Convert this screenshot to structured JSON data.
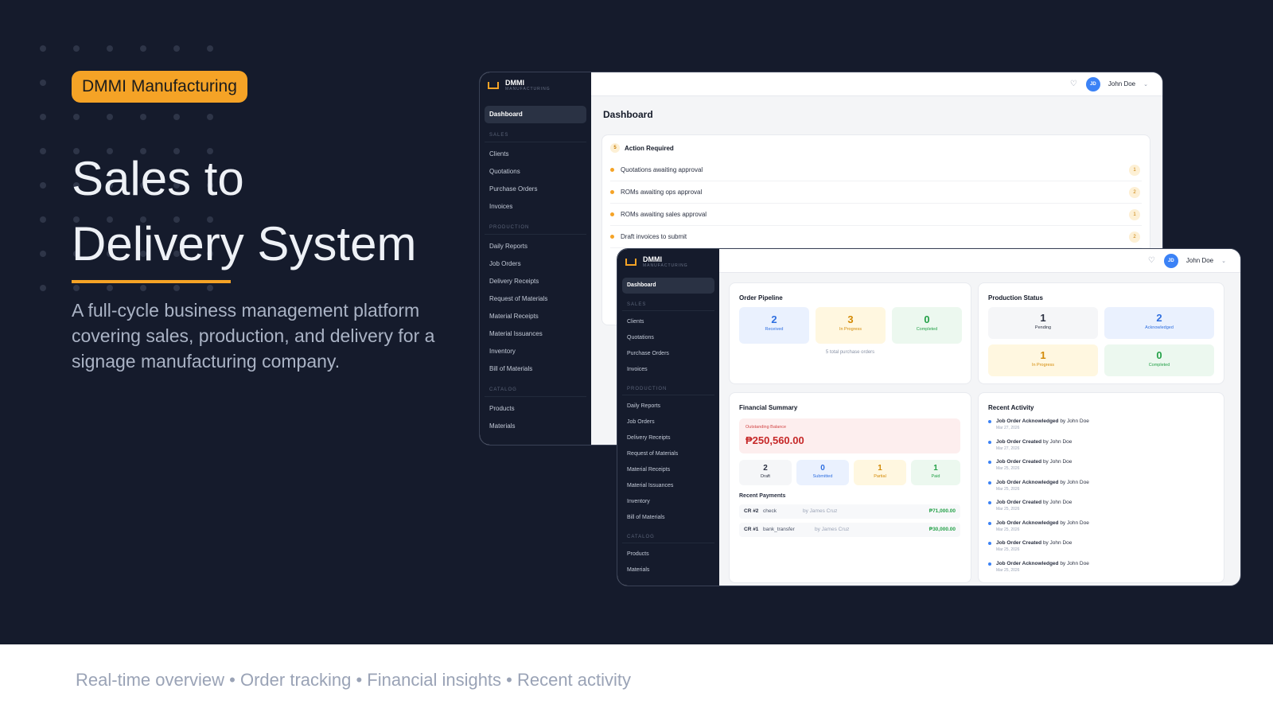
{
  "badge": "DMMI Manufacturing",
  "headline": {
    "line1": "Sales to",
    "line2": "Delivery System"
  },
  "subtitle": "A full-cycle business management platform covering sales, production, and delivery for a signage manufacturing company.",
  "footer": "Real-time overview • Order tracking • Financial insights • Recent activity",
  "colors": {
    "background": "#151b2c",
    "accent": "#f5a326",
    "primary": "#3b82f6",
    "success": "#24a148",
    "danger": "#c62828"
  },
  "brand": {
    "name": "DMMI",
    "sub": "MANUFACTURING"
  },
  "nav": {
    "dashboard": "Dashboard",
    "sales_section": "SALES",
    "sales": [
      "Clients",
      "Quotations",
      "Purchase Orders",
      "Invoices"
    ],
    "production_section": "PRODUCTION",
    "production": [
      "Daily Reports",
      "Job Orders",
      "Delivery Receipts",
      "Request of Materials",
      "Material Receipts",
      "Material Issuances",
      "Inventory",
      "Bill of Materials"
    ],
    "catalog_section": "CATALOG",
    "catalog": [
      "Products",
      "Materials"
    ]
  },
  "user": {
    "initials": "JD",
    "name": "John Doe"
  },
  "icons": {
    "bell": "bell-icon",
    "chevron": "chevron-down-icon",
    "logo": "factory-logo-icon"
  },
  "win1": {
    "page_title": "Dashboard",
    "action": {
      "title": "Action Required",
      "count": "5",
      "items": [
        {
          "label": "Quotations awaiting approval",
          "count": "1"
        },
        {
          "label": "ROMs awaiting ops approval",
          "count": "2"
        },
        {
          "label": "ROMs awaiting sales approval",
          "count": "1"
        },
        {
          "label": "Draft invoices to submit",
          "count": "2"
        }
      ]
    }
  },
  "pipeline": {
    "title": "Order Pipeline",
    "received": {
      "value": "2",
      "label": "Received"
    },
    "in_progress": {
      "value": "3",
      "label": "In Progress"
    },
    "completed": {
      "value": "0",
      "label": "Completed"
    },
    "note": "5 total purchase orders"
  },
  "production_status": {
    "title": "Production Status",
    "pending": {
      "value": "1",
      "label": "Pending"
    },
    "acknowledged": {
      "value": "2",
      "label": "Acknowledged"
    },
    "in_progress": {
      "value": "1",
      "label": "In Progress"
    },
    "completed": {
      "value": "0",
      "label": "Completed"
    }
  },
  "financial": {
    "title": "Financial Summary",
    "balance_label": "Outstanding Balance",
    "balance": "₱250,560.00",
    "draft": {
      "value": "2",
      "label": "Draft"
    },
    "submitted": {
      "value": "0",
      "label": "Submitted"
    },
    "partial": {
      "value": "1",
      "label": "Partial"
    },
    "paid": {
      "value": "1",
      "label": "Paid"
    },
    "payments_title": "Recent Payments",
    "payments": [
      {
        "ref": "CR #2",
        "method": "check",
        "by": "by James Cruz",
        "amount": "₱71,000.00"
      },
      {
        "ref": "CR #1",
        "method": "bank_transfer",
        "by": "by James Cruz",
        "amount": "₱30,000.00"
      }
    ]
  },
  "activity": {
    "title": "Recent Activity",
    "items": [
      {
        "action": "Job Order Acknowledged",
        "by": "by John Doe",
        "date": "Mar 27, 2026"
      },
      {
        "action": "Job Order Created",
        "by": "by John Doe",
        "date": "Mar 27, 2026"
      },
      {
        "action": "Job Order Created",
        "by": "by John Doe",
        "date": "Mar 25, 2026"
      },
      {
        "action": "Job Order Acknowledged",
        "by": "by John Doe",
        "date": "Mar 25, 2026"
      },
      {
        "action": "Job Order Created",
        "by": "by John Doe",
        "date": "Mar 25, 2026"
      },
      {
        "action": "Job Order Acknowledged",
        "by": "by John Doe",
        "date": "Mar 25, 2026"
      },
      {
        "action": "Job Order Created",
        "by": "by John Doe",
        "date": "Mar 25, 2026"
      },
      {
        "action": "Job Order Acknowledged",
        "by": "by John Doe",
        "date": "Mar 25, 2026"
      }
    ]
  }
}
